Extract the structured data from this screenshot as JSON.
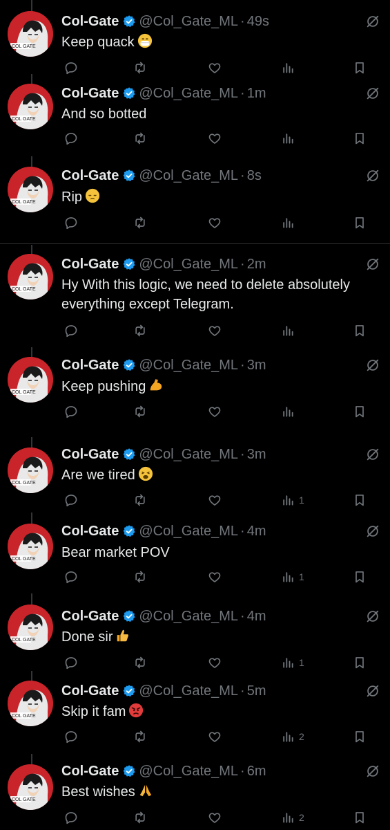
{
  "author": {
    "name": "Col-Gate",
    "handle": "@Col_Gate_ML",
    "avatar_label": "COL GATE"
  },
  "colors": {
    "background": "#000000",
    "text": "#e7e9ea",
    "muted": "#71767b",
    "verified": "#1d9bf0",
    "avatar": "#c8242a"
  },
  "icons": [
    "reply-icon",
    "retweet-icon",
    "like-icon",
    "views-icon",
    "bookmark-icon",
    "verified-badge-icon",
    "grok-icon"
  ],
  "tweets": [
    {
      "time": "49s",
      "text": "Keep quack",
      "emoji": "mask-face-emoji",
      "views": ""
    },
    {
      "time": "1m",
      "text": "And so botted",
      "emoji": "",
      "views": ""
    },
    {
      "time": "8s",
      "text": "Rip",
      "emoji": "pensive-face-emoji",
      "views": ""
    },
    {
      "time": "2m",
      "text": "Hy With this logic, we need to delete absolutely everything except Telegram.",
      "emoji": "",
      "views": ""
    },
    {
      "time": "3m",
      "text": "Keep pushing",
      "emoji": "flexed-biceps-emoji",
      "views": ""
    },
    {
      "time": "3m",
      "text": "Are we tired",
      "emoji": "weary-face-emoji",
      "views": "1"
    },
    {
      "time": "4m",
      "text": "Bear market POV",
      "emoji": "",
      "views": "1"
    },
    {
      "time": "4m",
      "text": "Done sir",
      "emoji": "thumbs-up-emoji",
      "views": "1"
    },
    {
      "time": "5m",
      "text": "Skip it fam",
      "emoji": "angry-face-emoji",
      "views": "2"
    },
    {
      "time": "6m",
      "text": "Best wishes",
      "emoji": "folded-hands-emoji",
      "views": "2"
    }
  ]
}
